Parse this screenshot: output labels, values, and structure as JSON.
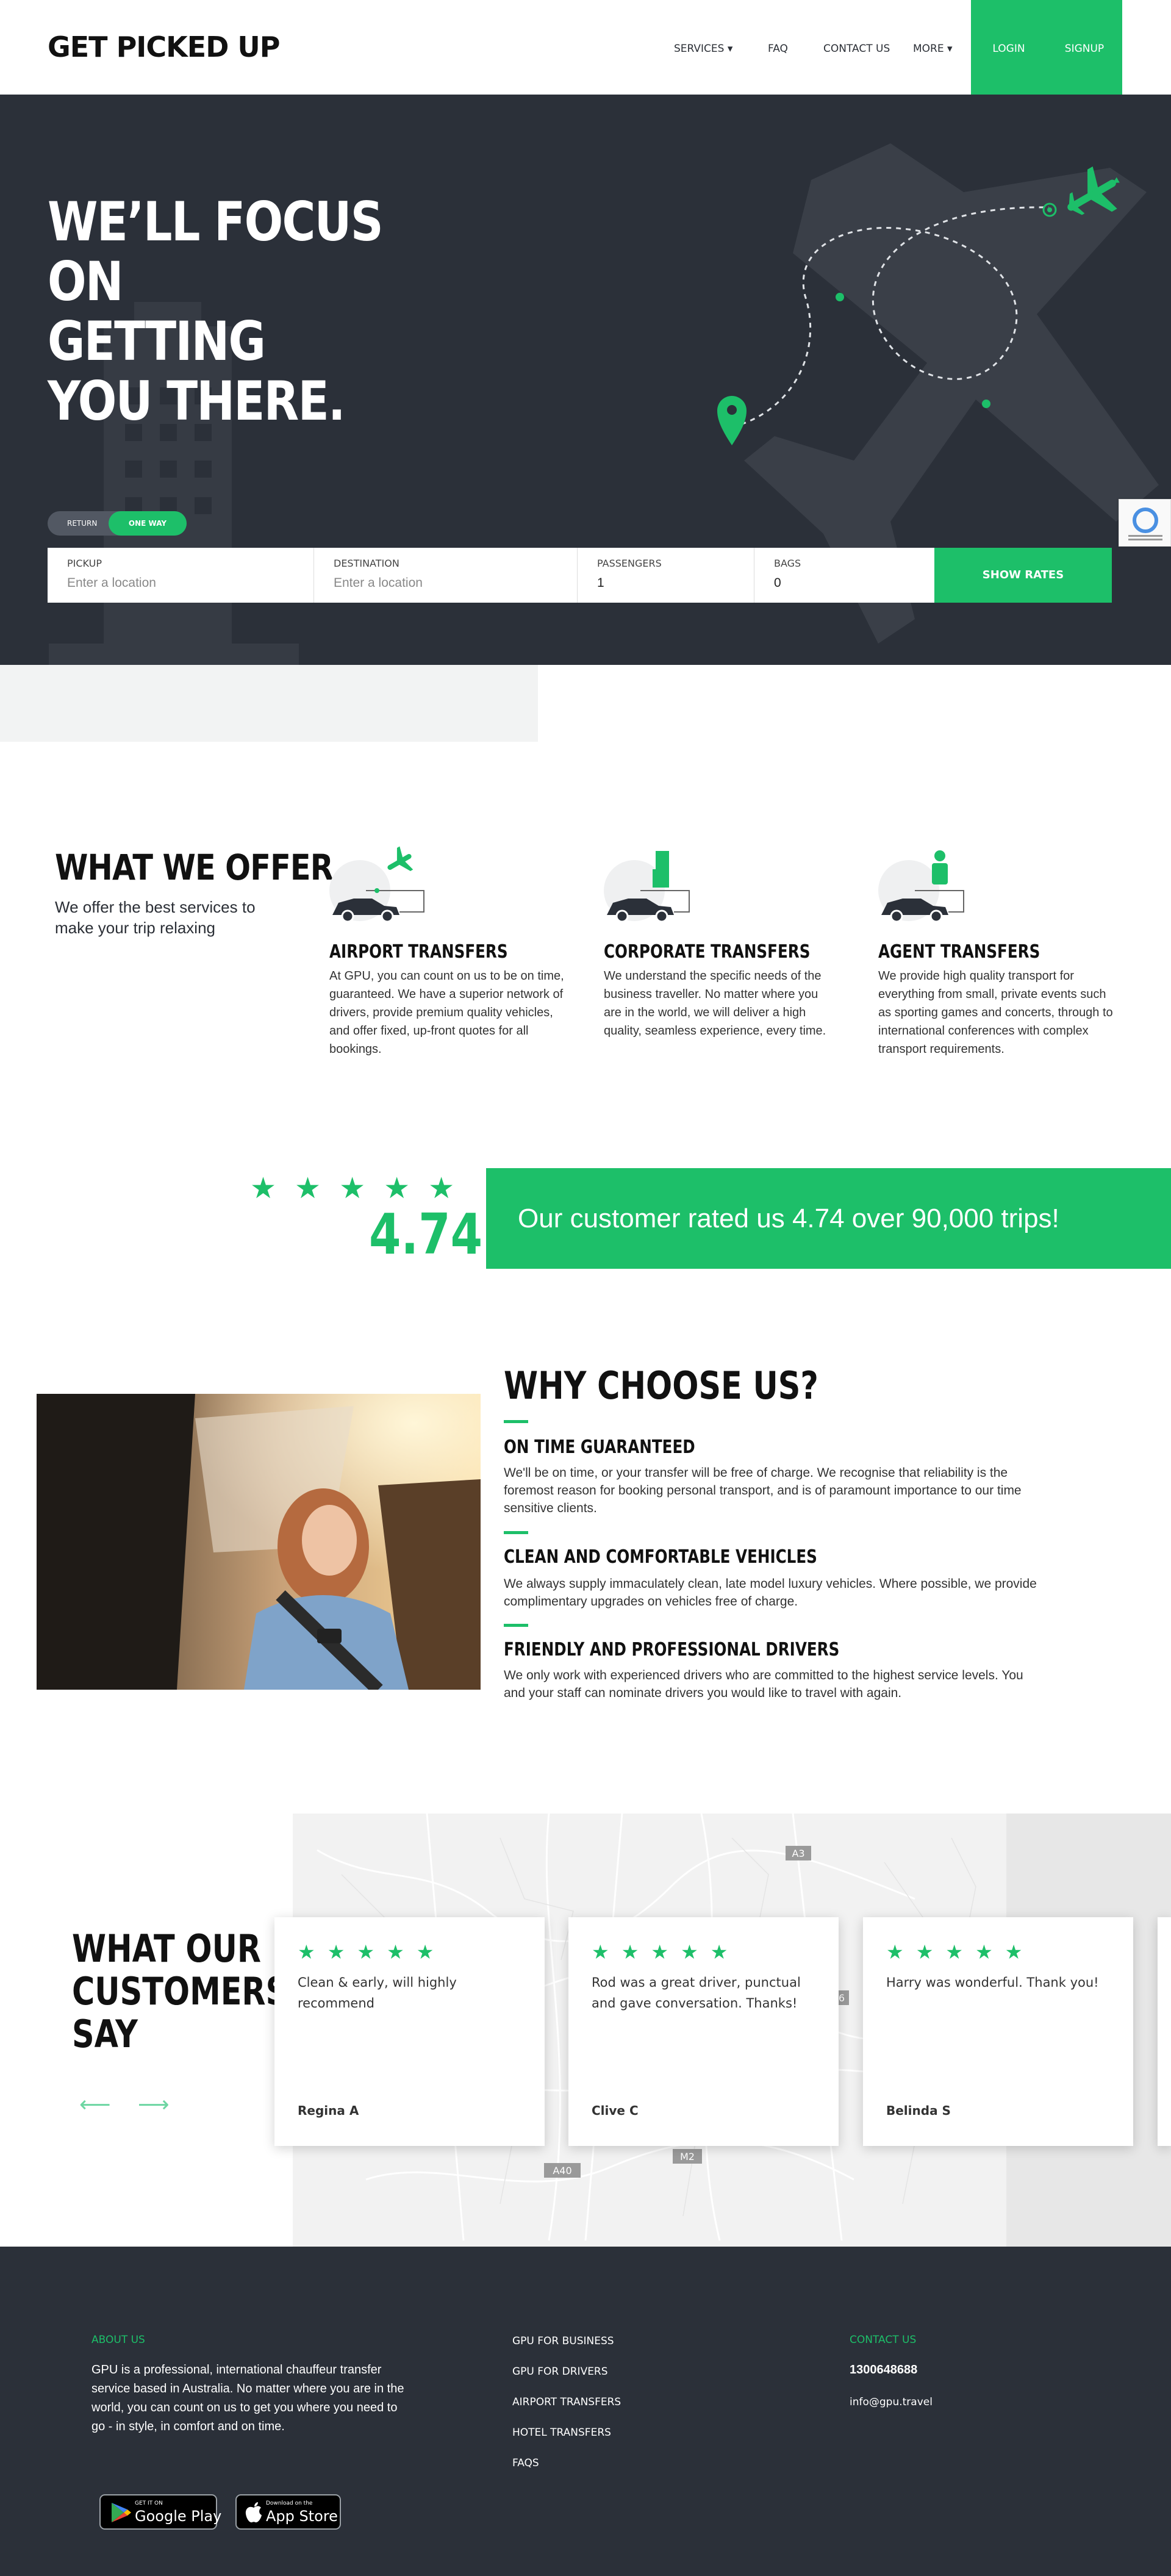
{
  "nav": {
    "logo": "GET PICKED UP",
    "items": [
      "SERVICES ▾",
      "FAQ",
      "CONTACT US",
      "MORE ▾"
    ],
    "login": "LOGIN",
    "signup": "SIGNUP"
  },
  "hero": {
    "title_l1": "WE’LL FOCUS ON",
    "title_l2": "GETTING",
    "title_l3": "YOU THERE.",
    "toggle_return": "RETURN",
    "toggle_oneway": "ONE WAY",
    "pickup_label": "PICKUP",
    "pickup_placeholder": "Enter a location",
    "destination_label": "DESTINATION",
    "destination_placeholder": "Enter a location",
    "passengers_label": "PASSENGERS",
    "passengers_value": "1",
    "bags_label": "BAGS",
    "bags_value": "0",
    "show_rates": "SHOW RATES"
  },
  "offer": {
    "title": "WHAT WE OFFER",
    "subtitle": "We offer the best services to make your trip relaxing",
    "items": [
      {
        "title": "AIRPORT TRANSFERS",
        "text": "At GPU, you can count on us to be on time, guaranteed. We have a superior network of drivers, provide premium quality vehicles, and offer fixed, up-front quotes for all bookings."
      },
      {
        "title": "CORPORATE TRANSFERS",
        "text": "We understand the specific needs of the business traveller. No matter where you are in the world, we will deliver a high quality, seamless experience, every time."
      },
      {
        "title": "AGENT TRANSFERS",
        "text": "We provide high quality transport for everything from small, private events such as sporting games and concerts, through to international conferences with complex transport requirements."
      }
    ]
  },
  "rating": {
    "stars": "★★★★★",
    "value": "4.74",
    "banner": "Our customer rated us 4.74 over 90,000 trips!"
  },
  "why": {
    "title": "WHY CHOOSE US?",
    "items": [
      {
        "title": "ON TIME GUARANTEED",
        "text": "We'll be on time, or your transfer will be free of charge. We recognise that reliability is the foremost reason for booking personal transport, and is of paramount importance to our time sensitive clients."
      },
      {
        "title": "CLEAN AND COMFORTABLE VEHICLES",
        "text": "We always supply immaculately clean, late model luxury vehicles. Where possible, we provide complimentary upgrades on vehicles free of charge."
      },
      {
        "title": "FRIENDLY AND PROFESSIONAL DRIVERS",
        "text": "We only work with experienced drivers who are committed to the highest service levels. You and your staff can nominate drivers you would like to travel with again."
      }
    ]
  },
  "testimonials": {
    "title_l1": "WHAT OUR",
    "title_l2": "CUSTOMERS",
    "title_l3": "SAY",
    "prev": "⟵",
    "next": "⟶",
    "map_labels": [
      "A3",
      "A40",
      "M2",
      "6"
    ],
    "items": [
      {
        "stars": "★★★★★",
        "quote": "Clean & early, will highly recommend",
        "name": "Regina A"
      },
      {
        "stars": "★★★★★",
        "quote": "Rod was a great driver, punctual and gave conversation. Thanks!",
        "name": "Clive C"
      },
      {
        "stars": "★★★★★",
        "quote": "Harry was wonderful. Thank you!",
        "name": "Belinda S"
      }
    ]
  },
  "footer": {
    "about_heading": "ABOUT US",
    "about_text": "GPU is a professional, international chauffeur transfer service based in Australia. No matter where you are in the world, you can count on us to get you where you need to go - in style, in comfort and on time.",
    "links": [
      "GPU FOR BUSINESS",
      "GPU FOR DRIVERS",
      "AIRPORT TRANSFERS",
      "HOTEL TRANSFERS",
      "FAQS"
    ],
    "contact_heading": "CONTACT US",
    "phone": "1300648688",
    "email": "info@gpu.travel",
    "google_small": "GET IT ON",
    "google_big": "Google Play",
    "apple_small": "Download on the",
    "apple_big": "App Store"
  },
  "colors": {
    "accent": "#1dbf69",
    "dark": "#2b3039"
  }
}
